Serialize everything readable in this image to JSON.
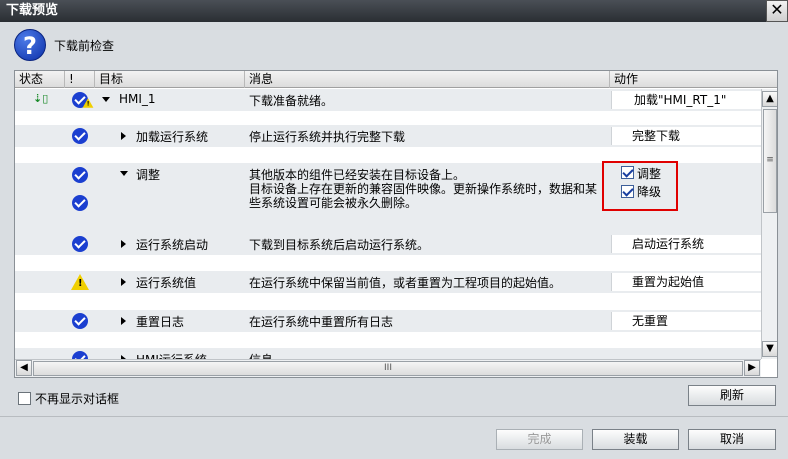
{
  "window": {
    "title": "下载预览",
    "close_label": "✕"
  },
  "header": {
    "title": "下载前检查"
  },
  "columns": [
    "状态",
    "!",
    "目标",
    "消息",
    "动作"
  ],
  "rows": [
    {
      "target": "HMI_1",
      "message": "下载准备就绪。",
      "action": "加载\"HMI_RT_1\""
    },
    {
      "target": "加载运行系统",
      "message": "停止运行系统并执行完整下载",
      "action": "完整下载"
    },
    {
      "target": "调整",
      "message": "其他版本的组件已经安装在目标设备上。",
      "action": "调整"
    },
    {
      "message_line1": "目标设备上存在更新的兼容固件映像。更新操作系统时，数据和某",
      "message_line2": "些系统设置可能会被永久删除。",
      "action": "降级"
    },
    {
      "target": "运行系统启动",
      "message": "下载到目标系统后启动运行系统。",
      "action": "启动运行系统"
    },
    {
      "target": "运行系统值",
      "message": "在运行系统中保留当前值，或者重置为工程项目的起始值。",
      "action": "重置为起始值"
    },
    {
      "target": "重置日志",
      "message": "在运行系统中重置所有日志",
      "action": "无重置"
    },
    {
      "target": "HMI运行系统",
      "message": "信息"
    }
  ],
  "checkboxes": {
    "adjust_checked": true,
    "downgrade_checked": true
  },
  "footer": {
    "dont_show_label": "不再显示对话框",
    "refresh_label": "刷新",
    "finish_label": "完成",
    "load_label": "装载",
    "cancel_label": "取消"
  },
  "scroll": {
    "thumb_grip": "≡",
    "hgrip": "III"
  },
  "colors": {
    "accent": "#1b3fd0",
    "warning": "#f0cf00",
    "highlight": "#e00000"
  }
}
